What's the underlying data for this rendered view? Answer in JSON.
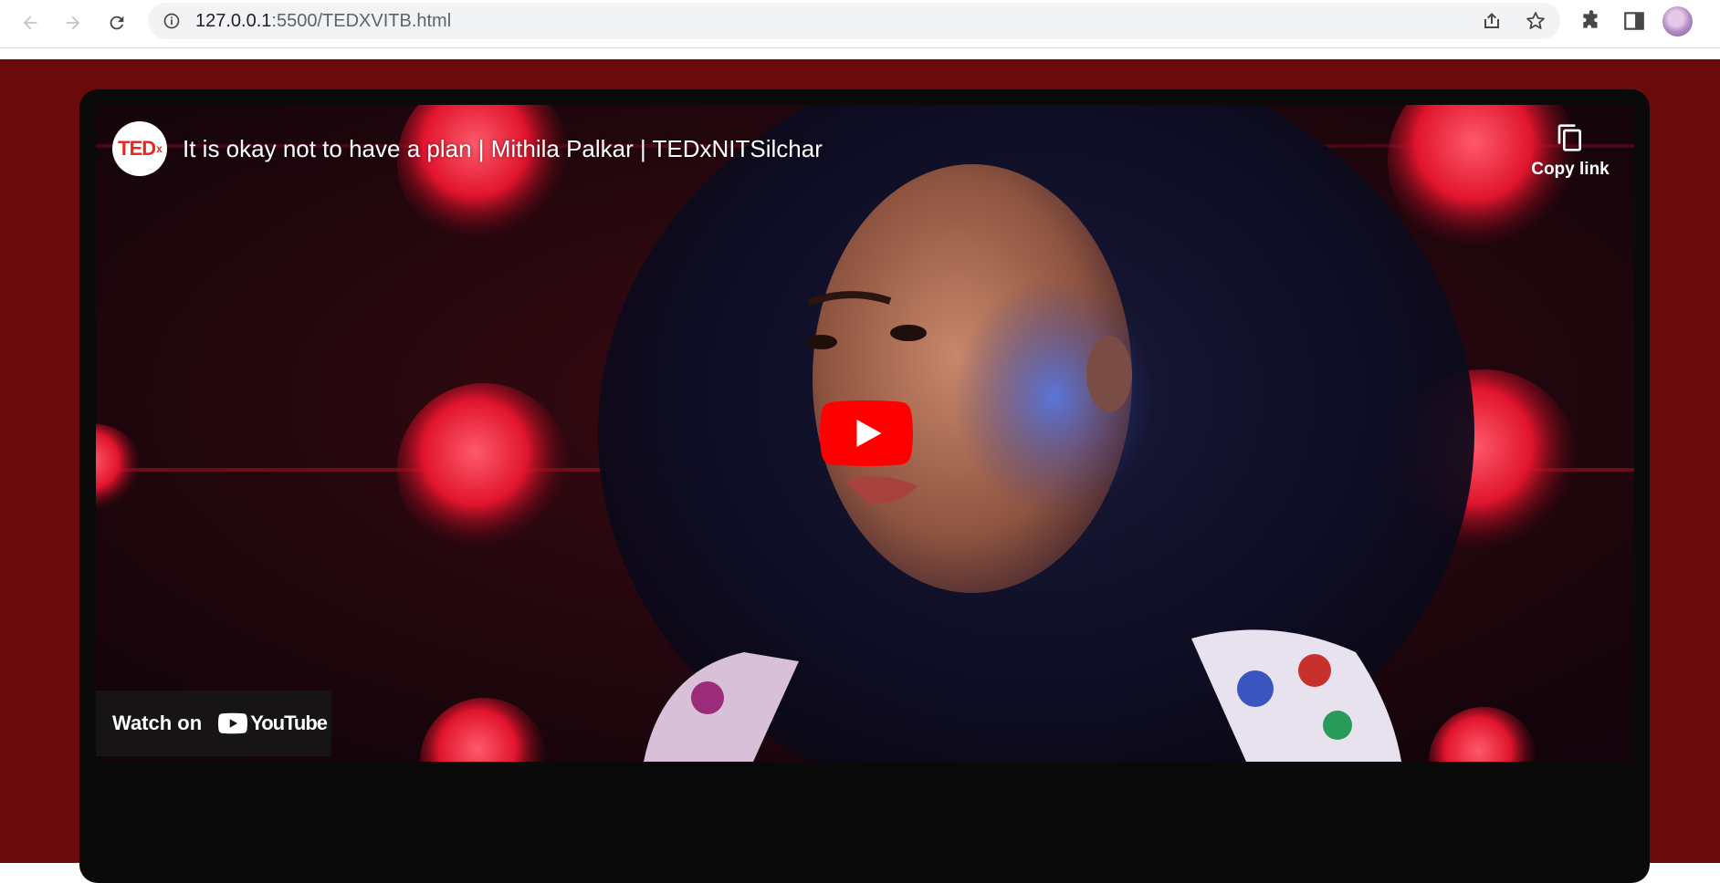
{
  "browser": {
    "url_host": "127.0.0.1",
    "url_rest": ":5500/TEDXVITB.html",
    "back_icon": "arrow-left-icon",
    "forward_icon": "arrow-right-icon",
    "reload_icon": "reload-icon",
    "info_icon": "info-icon",
    "share_icon": "share-icon",
    "bookmark_icon": "star-icon",
    "extensions_icon": "puzzle-icon",
    "sidepanel_icon": "side-panel-icon"
  },
  "video": {
    "channel_logo_text": "TED",
    "channel_logo_sup": "x",
    "title": "It is okay not to have a plan | Mithila Palkar | TEDxNITSilchar",
    "copy_link_label": "Copy link",
    "watch_on_label": "Watch on",
    "youtube_word": "YouTube"
  },
  "colors": {
    "page_bg": "#6b0a0a",
    "card_bg": "#0b0a0b",
    "youtube_red": "#ff0000",
    "tedx_red": "#e62b1e"
  }
}
